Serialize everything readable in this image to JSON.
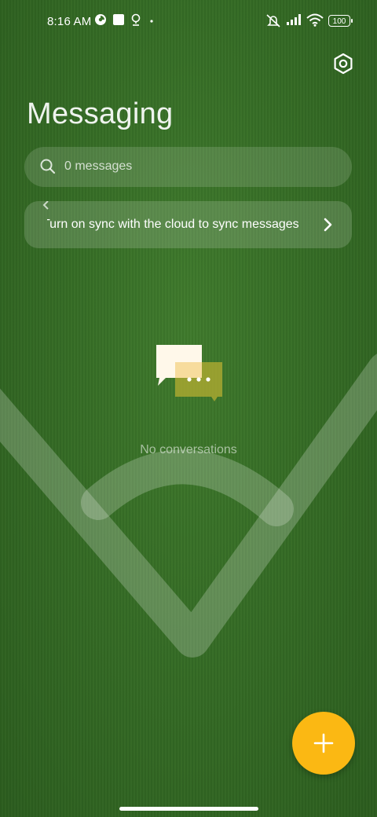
{
  "status_bar": {
    "time": "8:16 AM",
    "battery": "100",
    "icons": [
      "data-saver-icon",
      "notification-square-icon",
      "location-pin-icon",
      "dot-icon",
      "silent-mode-icon",
      "signal-icon",
      "wifi-icon",
      "battery-icon"
    ]
  },
  "header": {
    "title": "Messaging",
    "settings_icon": "settings-hexagon-icon"
  },
  "search": {
    "placeholder": "0 messages"
  },
  "sync_banner": {
    "text": "Turn on sync with the cloud to sync messages"
  },
  "empty_state": {
    "text": "No conversations"
  },
  "fab": {
    "icon": "plus-icon",
    "color": "#fbb813"
  },
  "colors": {
    "background": "#356c25",
    "accent": "#fbb813"
  }
}
